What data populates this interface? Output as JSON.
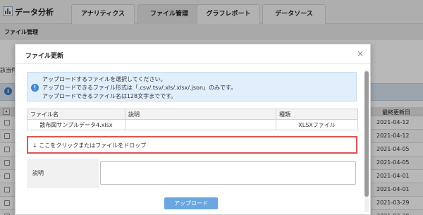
{
  "app": {
    "title": "データ分析"
  },
  "tabs": [
    {
      "label": "アナリティクス",
      "active": false
    },
    {
      "label": "ファイル管理",
      "active": true
    },
    {
      "label": "グラフレポート",
      "active": false
    },
    {
      "label": "データソース",
      "active": false
    }
  ],
  "subheader": {
    "title": "ファイル管理"
  },
  "background": {
    "label": "該当件",
    "column_last_updated": "最終更新日",
    "sort_icon": "chevron-down-icon",
    "rows": [
      {
        "date": "2021-04-12"
      },
      {
        "date": "2021-04-12"
      },
      {
        "date": "2021-04-05"
      },
      {
        "date": "2021-04-05"
      },
      {
        "date": "2021-04-01"
      },
      {
        "date": "2021-04-01"
      },
      {
        "date": "2021-03-29"
      },
      {
        "date": "2021-03-29"
      }
    ]
  },
  "modal": {
    "title": "ファイル更新",
    "close_icon": "close-icon",
    "notice": {
      "icon": "info-icon",
      "lines": [
        "アップロードするファイルを選択してください。",
        "アップロードできるファイル形式は「.csv/.tsv/.xls/.xlsx/.json」のみです。",
        "アップロードできるファイル名は128文字までです。"
      ]
    },
    "table": {
      "headers": [
        "ファイル名",
        "説明",
        "種類"
      ],
      "rows": [
        {
          "name": "散布図サンプルデータ4.xlsx",
          "description": "",
          "type": "XLSXファイル"
        }
      ]
    },
    "drop_zone": {
      "text": "↓ ここをクリックまたはファイルをドロップ"
    },
    "description": {
      "label": "説明",
      "value": ""
    },
    "upload_button": "アップロード"
  },
  "colors": {
    "accent": "#6aa6e2",
    "drop_border": "#e05252",
    "notice_bg": "#e1eefb"
  }
}
